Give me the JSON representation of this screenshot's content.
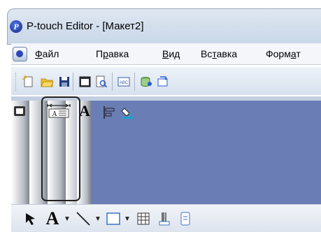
{
  "window": {
    "title": "P-touch Editor - [Макет2]",
    "app_icon_glyph": "P"
  },
  "menu": {
    "items": [
      {
        "label": "Файл",
        "mnemonic_index": 0
      },
      {
        "label": "Правка",
        "mnemonic_index": 1
      },
      {
        "label": "Вид",
        "mnemonic_index": 0
      },
      {
        "label": "Вставка",
        "mnemonic_index": 2
      },
      {
        "label": "Формат",
        "mnemonic_index": 4
      }
    ]
  },
  "toolbar": {
    "buttons": [
      "new-icon",
      "open-icon",
      "save-icon",
      "print-icon",
      "print-preview-icon",
      "text-abc-icon",
      "database-icon",
      "transfer-icon"
    ]
  },
  "side_tabs": [
    {
      "name": "paper-tab",
      "icon": "paper-icon"
    },
    {
      "name": "text-layout-tab",
      "icon": "text-layout-icon"
    },
    {
      "name": "font-tab",
      "icon": "font-icon",
      "glyph": "A"
    },
    {
      "name": "align-tab",
      "icon": "align-icon"
    },
    {
      "name": "fill-tab",
      "icon": "fill-icon"
    }
  ],
  "draw_toolbar": {
    "text_tool_glyph": "A",
    "tools": [
      "pointer-icon",
      "text-icon",
      "line-icon",
      "rectangle-icon",
      "table-icon",
      "barcode-icon",
      "clipart-icon"
    ]
  },
  "colors": {
    "canvas": "#6b7db5",
    "title_gradient": "#c9d7e8"
  }
}
